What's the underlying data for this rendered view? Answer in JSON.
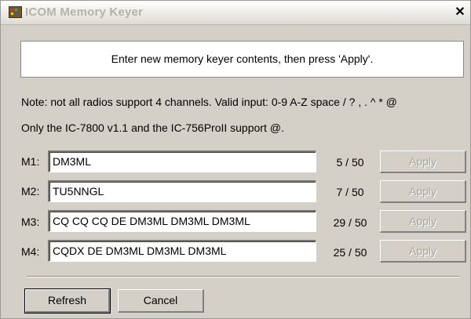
{
  "window": {
    "title": "ICOM Memory Keyer",
    "close_glyph": "✕"
  },
  "banner": {
    "text": "Enter new memory keyer contents, then press 'Apply'."
  },
  "notes": {
    "line1": "Note: not all radios support 4 channels. Valid input: 0-9 A-Z space / ? , . ^ * @",
    "line2": "Only the IC-7800 v1.1 and the IC-756ProII support @."
  },
  "memories": [
    {
      "label": "M1:",
      "value": "DM3ML",
      "count": "5 / 50",
      "apply": "Apply"
    },
    {
      "label": "M2:",
      "value": "TU5NNGL",
      "count": "7 / 50",
      "apply": "Apply"
    },
    {
      "label": "M3:",
      "value": "CQ CQ CQ DE DM3ML DM3ML DM3ML",
      "count": "29 / 50",
      "apply": "Apply"
    },
    {
      "label": "M4:",
      "value": "CQDX DE DM3ML DM3ML DM3ML",
      "count": "25 / 50",
      "apply": "Apply"
    }
  ],
  "buttons": {
    "refresh": "Refresh",
    "cancel": "Cancel"
  },
  "colors": {
    "dialog_bg": "#d4d0c8",
    "disabled_text": "#a8a59e"
  }
}
